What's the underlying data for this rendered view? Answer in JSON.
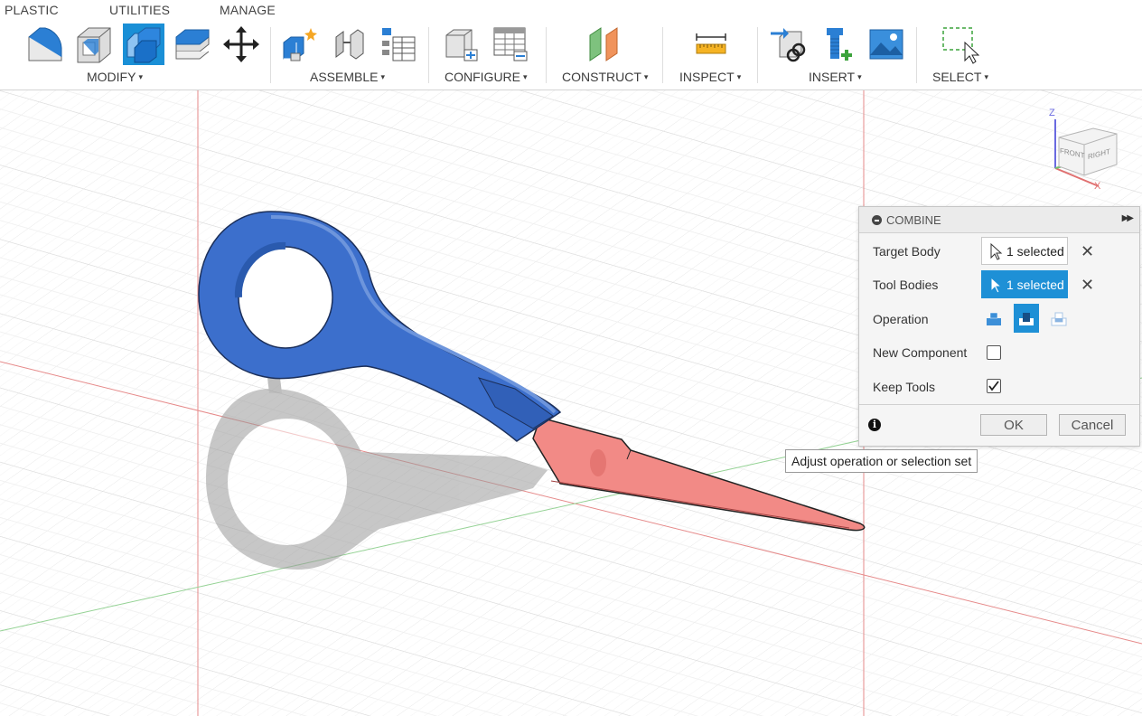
{
  "toolbar": {
    "tabs": [
      "PLASTIC",
      "UTILITIES",
      "MANAGE"
    ],
    "groups": {
      "modify": "MODIFY",
      "assemble": "ASSEMBLE",
      "configure": "CONFIGURE",
      "construct": "CONSTRUCT",
      "inspect": "INSPECT",
      "insert": "INSERT",
      "select": "SELECT"
    },
    "caret": "▾",
    "icons": [
      "fillet-icon",
      "shell-icon",
      "combine-icon",
      "offset-face-icon",
      "move-icon",
      "new-component-icon",
      "joint-icon",
      "bom-table-icon",
      "configure-icon",
      "configure-table-icon",
      "construct-plane-icon",
      "measure-icon",
      "insert-derive-icon",
      "insert-mcmaster-icon",
      "canvas-image-icon",
      "window-select-icon"
    ]
  },
  "viewcube": {
    "front": "FRONT",
    "right": "RIGHT",
    "z": "Z",
    "x": "X"
  },
  "combine": {
    "title": "COMBINE",
    "target_label": "Target Body",
    "target_value": "1 selected",
    "tool_label": "Tool Bodies",
    "tool_value": "1 selected",
    "operation_label": "Operation",
    "operation_selected": "cut",
    "new_component_label": "New Component",
    "new_component_checked": false,
    "keep_tools_label": "Keep Tools",
    "keep_tools_checked": true,
    "ok": "OK",
    "cancel": "Cancel",
    "info": "i"
  },
  "tooltip": "Adjust operation or selection set",
  "colors": {
    "accent": "#1e90d6",
    "tool_body": "#3a6fc8",
    "target_body": "#f08080",
    "grid": "#d8d8d8",
    "axis_red": "#e06060",
    "axis_green": "#7cc77c"
  }
}
